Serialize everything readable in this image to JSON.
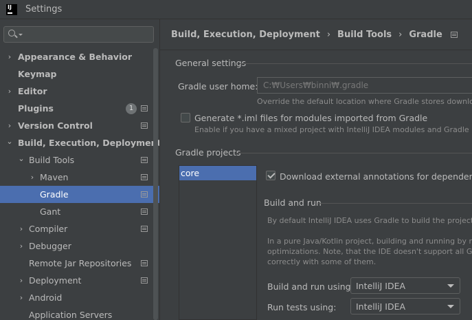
{
  "window": {
    "title": "Settings",
    "logo_text": "IJ"
  },
  "search": {
    "value": "",
    "placeholder": ""
  },
  "sidebar": {
    "items": [
      {
        "label": "Appearance & Behavior",
        "expander": "›"
      },
      {
        "label": "Keymap"
      },
      {
        "label": "Editor",
        "expander": "›"
      },
      {
        "label": "Plugins",
        "badge": "1"
      },
      {
        "label": "Version Control",
        "expander": "›"
      },
      {
        "label": "Build, Execution, Deployment",
        "expander": "⌄"
      },
      {
        "label": "Build Tools",
        "expander": "⌄"
      },
      {
        "label": "Maven",
        "expander": "›"
      },
      {
        "label": "Gradle"
      },
      {
        "label": "Gant"
      },
      {
        "label": "Compiler",
        "expander": "›"
      },
      {
        "label": "Debugger",
        "expander": "›"
      },
      {
        "label": "Remote Jar Repositories"
      },
      {
        "label": "Deployment",
        "expander": "›"
      },
      {
        "label": "Android",
        "expander": "›"
      },
      {
        "label": "Application Servers"
      }
    ]
  },
  "breadcrumb": {
    "items": [
      "Build, Execution, Deployment",
      "Build Tools",
      "Gradle"
    ],
    "separator": "›"
  },
  "general": {
    "title": "General settings",
    "user_home_label": "Gradle user home:",
    "user_home_placeholder": "C:₩Users₩binni₩.gradle",
    "user_home_hint": "Override the default location where Gradle stores downloade",
    "iml_label": "Generate *.iml files for modules imported from Gradle",
    "iml_hint": "Enable if you have a mixed project with IntelliJ IDEA modules and Gradle mod"
  },
  "projects": {
    "title": "Gradle projects",
    "list": [
      "core"
    ],
    "download_annotations_label": "Download external annotations for dependencies"
  },
  "build_run": {
    "title": "Build and run",
    "desc1": "By default IntelliJ IDEA uses Gradle to build the project an",
    "desc2_line1": "In a pure Java/Kotlin project, building and running by mea",
    "desc2_line2": "optimizations. Note, that the IDE doesn't support all Grad",
    "desc2_line3": "correctly with some of them.",
    "build_run_label": "Build and run using:",
    "build_run_value": "IntelliJ IDEA",
    "run_tests_label": "Run tests using:",
    "run_tests_value": "IntelliJ IDEA"
  }
}
